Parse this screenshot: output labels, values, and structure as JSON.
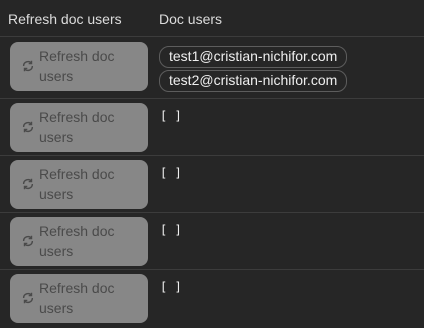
{
  "header": {
    "col1": "Refresh doc users",
    "col2": "Doc users"
  },
  "rows": [
    {
      "button_label": "Refresh doc users",
      "users": [
        "test1@cristian-nichifor.com",
        "test2@cristian-nichifor.com"
      ]
    },
    {
      "button_label": "Refresh doc users",
      "users_text": "[ ]"
    },
    {
      "button_label": "Refresh doc users",
      "users_text": "[ ]"
    },
    {
      "button_label": "Refresh doc users",
      "users_text": "[ ]"
    },
    {
      "button_label": "Refresh doc users",
      "users_text": "[ ]"
    }
  ],
  "icons": {
    "refresh": "refresh-icon"
  },
  "colors": {
    "background": "#262626",
    "button": "#878787",
    "button_text": "#4a4a4a",
    "text": "#e9e9e9"
  }
}
